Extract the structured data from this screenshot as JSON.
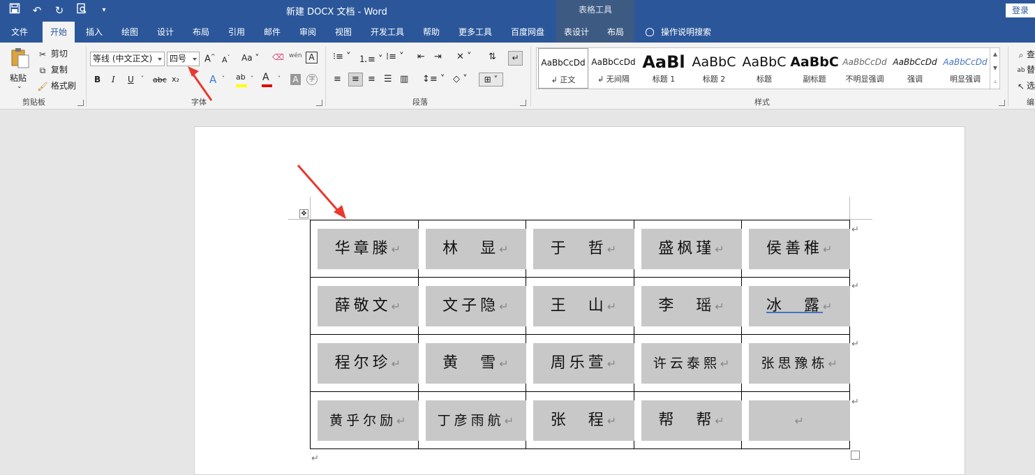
{
  "titlebar": {
    "doc_title": "新建 DOCX 文档  -  Word",
    "context_title": "表格工具",
    "login": "登录"
  },
  "tabs": [
    {
      "label": "文件"
    },
    {
      "label": "开始"
    },
    {
      "label": "插入"
    },
    {
      "label": "绘图"
    },
    {
      "label": "设计"
    },
    {
      "label": "布局"
    },
    {
      "label": "引用"
    },
    {
      "label": "邮件"
    },
    {
      "label": "审阅"
    },
    {
      "label": "视图"
    },
    {
      "label": "开发工具"
    },
    {
      "label": "帮助"
    },
    {
      "label": "更多工具"
    },
    {
      "label": "百度网盘"
    },
    {
      "label": "表设计"
    },
    {
      "label": "布局"
    }
  ],
  "tell_me": "操作说明搜索",
  "clipboard": {
    "paste": "粘贴",
    "cut": "剪切",
    "copy": "复制",
    "format_painter": "格式刷",
    "group_label": "剪贴板"
  },
  "font": {
    "font_name": "等线 (中文正文)",
    "font_size": "四号",
    "group_label": "字体",
    "aa_label": "Aa",
    "bold": "B",
    "italic": "I",
    "underline": "U",
    "strike": "abc",
    "subscript": "x₂",
    "font_color_letter": "A",
    "shade_letter": "A"
  },
  "paragraph": {
    "group_label": "段落"
  },
  "styles": {
    "group_label": "样式",
    "items": [
      {
        "preview": "AaBbCcDd",
        "name": "正文"
      },
      {
        "preview": "AaBbCcDd",
        "name": "无间隔"
      },
      {
        "preview": "AaBl",
        "name": "标题 1"
      },
      {
        "preview": "AaBbC",
        "name": "标题 2"
      },
      {
        "preview": "AaBbC",
        "name": "标题"
      },
      {
        "preview": "AaBbC",
        "name": "副标题"
      },
      {
        "preview": "AaBbCcDd",
        "name": "不明显强调"
      },
      {
        "preview": "AaBbCcDd",
        "name": "强调"
      },
      {
        "preview": "AaBbCcDd",
        "name": "明显强调"
      }
    ]
  },
  "editing": {
    "find": "查",
    "replace": "替",
    "select": "选",
    "group_label": "编"
  },
  "table": {
    "rows": [
      [
        "华章滕",
        "林　显",
        "于　哲",
        "盛枫瑾",
        "侯善稚"
      ],
      [
        "薛敬文",
        "文子隐",
        "王　山",
        "李　瑶",
        "冰　露"
      ],
      [
        "程尔珍",
        "黄　雪",
        "周乐萱",
        "许云泰熙",
        "张思豫栋"
      ],
      [
        "黄乎尔励",
        "丁彦雨航",
        "张　程",
        "帮　帮",
        ""
      ]
    ]
  },
  "colors": {
    "titlebar": "#2b579a",
    "ribbon": "#f3f3f3",
    "cell_fill": "#c8c8c8",
    "arrow": "#e8392e",
    "font_color": "#e00000",
    "highlight": "#ffff00"
  }
}
